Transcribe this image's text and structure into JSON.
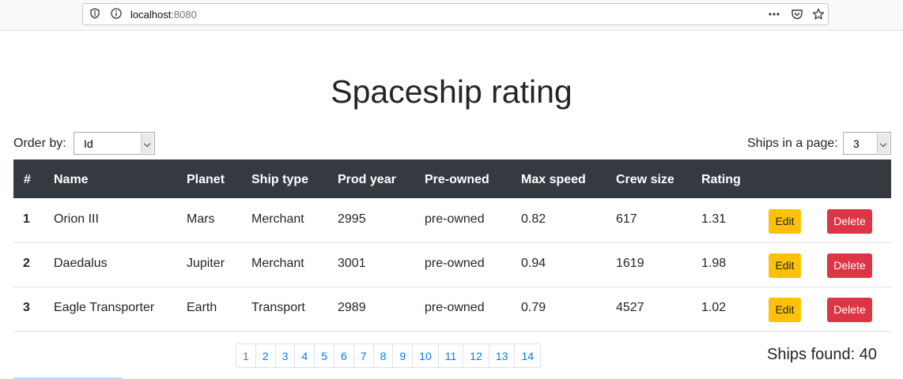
{
  "browser": {
    "url_host": "localhost",
    "url_port": ":8080",
    "icons": [
      "shield-icon",
      "info-icon",
      "more-icon",
      "pocket-icon",
      "star-icon"
    ]
  },
  "page": {
    "title": "Spaceship rating",
    "order_label": "Order by:",
    "order_value": "Id",
    "pagesize_label": "Ships in a page:",
    "pagesize_value": "3",
    "found_text": "Ships found: 40"
  },
  "table": {
    "headers": [
      "#",
      "Name",
      "Planet",
      "Ship type",
      "Prod year",
      "Pre-owned",
      "Max speed",
      "Crew size",
      "Rating"
    ],
    "rows": [
      [
        "1",
        "Orion III",
        "Mars",
        "Merchant",
        "2995",
        "pre-owned",
        "0.82",
        "617",
        "1.31"
      ],
      [
        "2",
        "Daedalus",
        "Jupiter",
        "Merchant",
        "3001",
        "pre-owned",
        "0.94",
        "1619",
        "1.98"
      ],
      [
        "3",
        "Eagle Transporter",
        "Earth",
        "Transport",
        "2989",
        "pre-owned",
        "0.79",
        "4527",
        "1.02"
      ]
    ],
    "edit_label": "Edit",
    "delete_label": "Delete"
  },
  "pagination": [
    "1",
    "2",
    "3",
    "4",
    "5",
    "6",
    "7",
    "8",
    "9",
    "10",
    "11",
    "12",
    "13",
    "14"
  ],
  "colors": {
    "header_bg": "#343a40",
    "edit": "#ffc107",
    "delete": "#dc3545",
    "link": "#007bff"
  }
}
